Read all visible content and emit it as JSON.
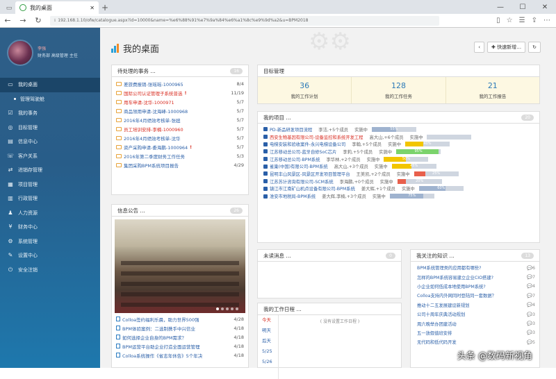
{
  "browser": {
    "tab_title": "我的桌面",
    "url_prefix": "ℹ",
    "url": "192.168.1.10/ofw/catalogue.aspx?id=10000&name=%e6%88%91%e7%9a%84%e6%a1%8c%e9%9d%a2&u=BPM2018"
  },
  "profile": {
    "name": "李强",
    "sub": "财务部 高级管理 主任"
  },
  "sidebar": {
    "items": [
      {
        "label": "我的桌面",
        "icon": "▭"
      },
      {
        "label": "管理驾驶舱",
        "icon": "•"
      },
      {
        "label": "我的事务",
        "icon": "☑"
      },
      {
        "label": "目标管理",
        "icon": "◎"
      },
      {
        "label": "信息中心",
        "icon": "▤"
      },
      {
        "label": "客户关系",
        "icon": "☏"
      },
      {
        "label": "进销存管理",
        "icon": "⇄"
      },
      {
        "label": "项目管理",
        "icon": "▦"
      },
      {
        "label": "行政管理",
        "icon": "▥"
      },
      {
        "label": "人力资源",
        "icon": "♟"
      },
      {
        "label": "财务中心",
        "icon": "¥"
      },
      {
        "label": "系统管理",
        "icon": "⚙"
      },
      {
        "label": "设置中心",
        "icon": "✎"
      },
      {
        "label": "安全注销",
        "icon": "⏻"
      }
    ]
  },
  "header": {
    "title": "我的桌面",
    "prev_label": "‹",
    "quick_new_label": "快速新增…",
    "refresh_icon": "↻"
  },
  "todo": {
    "title": "待处理的事务 …",
    "count": "16",
    "items": [
      {
        "text": "差旅费报销-张瑶瑶-1000965",
        "date": "8/4",
        "red": false,
        "excl": ""
      },
      {
        "text": "国际公司认证管理子系统普选",
        "date": "11/19",
        "red": true,
        "excl": "!"
      },
      {
        "text": "用车申请-沈华-1000971",
        "date": "5/7",
        "red": true,
        "excl": ""
      },
      {
        "text": "商品领用申请-沈海峰-1000968",
        "date": "5/7",
        "red": false,
        "excl": ""
      },
      {
        "text": "2016年4月绩效考核单-张妞",
        "date": "5/7",
        "red": false,
        "excl": ""
      },
      {
        "text": "员工培训安排-李楠-1000960",
        "date": "5/7",
        "red": true,
        "excl": ""
      },
      {
        "text": "2016年4月绩效考核单-沈华",
        "date": "5/7",
        "red": false,
        "excl": ""
      },
      {
        "text": "资产采购申请-委海鹏-1000964",
        "date": "5/7",
        "red": false,
        "excl": "!"
      },
      {
        "text": "2016年第二季度财务工作任务",
        "date": "5/3",
        "red": false,
        "excl": ""
      },
      {
        "text": "集团采购BPM系统项目报告",
        "date": "4/29",
        "red": false,
        "excl": ""
      }
    ]
  },
  "goals": {
    "title": "目标管理",
    "cells": [
      {
        "num": "36",
        "label": "我的工作计划"
      },
      {
        "num": "128",
        "label": "我的工作任务"
      },
      {
        "num": "21",
        "label": "我的工作报告"
      }
    ]
  },
  "projects": {
    "title": "我的项目 …",
    "count": "20",
    "items": [
      {
        "name": "PD-新品研发项目流程",
        "meta": "李洁,+5个成员",
        "status": "实施中",
        "pct": 55,
        "pct_label": "55%",
        "color": "#9fb3cf",
        "red": false
      },
      {
        "name": "西安生物基因有限公司-设备监控和系统开发工程",
        "meta": "高大山,+6个成员",
        "status": "实施中",
        "pct": 0,
        "pct_label": "",
        "color": "#9fb3cf",
        "red": true
      },
      {
        "name": "电梯安装和验收案件-永兴电梯设备公司",
        "meta": "李翰,+5个成员",
        "status": "实施中",
        "pct": 40,
        "pct_label": "40%",
        "color": "#f2c500",
        "red": false
      },
      {
        "name": "江苏移动总公司-蓝牙自修SoC芯片",
        "meta": "李莉,+5个成员",
        "status": "实施中",
        "pct": 95,
        "pct_label": "95%",
        "color": "#7bd36c",
        "red": false
      },
      {
        "name": "江苏移动总公司-BPM系统",
        "meta": "李华林,+2个成员",
        "status": "实施中",
        "pct": 50,
        "pct_label": "50%",
        "color": "#f2c500",
        "red": false
      },
      {
        "name": "雀巢(中国)有限公司-BPM系统",
        "meta": "高大山,+3个成员",
        "status": "实施中",
        "pct": 45,
        "pct_label": "45%",
        "color": "#f2c500",
        "red": false
      },
      {
        "name": "昆明丰山风景区-风景区开发项目管理平台",
        "meta": "王美凯,+2个成员",
        "status": "实施中",
        "pct": 25,
        "pct_label": "25%",
        "color": "#e8604c",
        "red": false
      },
      {
        "name": "江苏苏计咨询有限公司-SCM系统",
        "meta": "李海鹏,+0个成员",
        "status": "实施中",
        "pct": 20,
        "pct_label": "20%",
        "color": "#e8604c",
        "red": false
      },
      {
        "name": "镇江市江南矿山机点设备有限公司-BPM系统",
        "meta": "姜大辉,+1个成员",
        "status": "实施中",
        "pct": 60,
        "pct_label": "60%",
        "color": "#9fb3cf",
        "red": false
      },
      {
        "name": "淮安市地税局-BPM系统",
        "meta": "姜大辉,李楠,+3个成员",
        "status": "实施中",
        "pct": 75,
        "pct_label": "75%",
        "color": "#9fb3cf",
        "red": false
      }
    ]
  },
  "news": {
    "title": "信息公告 …",
    "count": "26",
    "items": [
      {
        "text": "Colloa签约福利乐晨，助力世界500强",
        "date": "4/28"
      },
      {
        "text": "BPM体验案例：二选制携手中兴信业",
        "date": "4/18"
      },
      {
        "text": "如何选择企业自身的BPM需求？",
        "date": "4/18"
      },
      {
        "text": "BPM运营平台助企业打造全面运营管理",
        "date": "4/18"
      },
      {
        "text": "Colloa系统操作《省志年休告》5个年决",
        "date": "4/18"
      }
    ]
  },
  "unread": {
    "title": "未读消息 …",
    "count": "0"
  },
  "schedule": {
    "title": "我的工作日程 …",
    "days": [
      "今天",
      "明天",
      "后天",
      "5/25",
      "5/26"
    ],
    "empty": "( 没有设置工作日程 )"
  },
  "knowledge": {
    "title": "我关注的知识 …",
    "count": "13",
    "items": [
      {
        "text": "BPM系统管理类的应用都有哪些?",
        "c": "6"
      },
      {
        "text": "怎样的BPM系统容易建立企业CIO搭建?",
        "c": "7"
      },
      {
        "text": "小企业如何低成本地使用BPM系统?",
        "c": "4"
      },
      {
        "text": "Colloa支持内外网同时登陆同一套数据？",
        "c": "7"
      },
      {
        "text": "推动十二五发展建设新规划",
        "c": "4"
      },
      {
        "text": "公司十周年庆典活动规划",
        "c": "3"
      },
      {
        "text": "周六晚举办团建活动",
        "c": "3"
      },
      {
        "text": "五一放假值班安排",
        "c": "3"
      },
      {
        "text": "无代码和低代码开发",
        "c": "5"
      }
    ]
  },
  "watermark": {
    "text": "头条 @数码新视角",
    "logo": "路由器"
  },
  "colors": {
    "sidebar": "#285d89",
    "link": "#2a5fa8",
    "alert": "#d82c20",
    "accent": "#2aa0d8"
  }
}
